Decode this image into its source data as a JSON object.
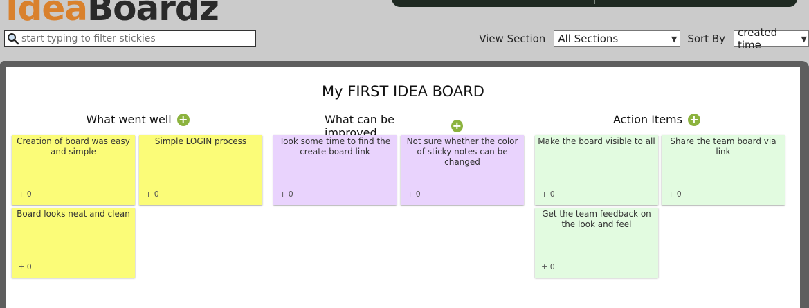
{
  "header": {
    "logo_part1": "Idea",
    "logo_part2": "Boardz",
    "search_placeholder": "start typing to filter stickies",
    "view_section_label": "View Section",
    "view_section_value": "All Sections",
    "sort_by_label": "Sort By",
    "sort_by_value": "created time"
  },
  "board": {
    "title": "My FIRST IDEA BOARD",
    "columns": [
      {
        "title": "What went well",
        "stickies": [
          {
            "text": "Creation of board was easy and simple",
            "votes": "+ 0"
          },
          {
            "text": "Simple LOGIN process",
            "votes": "+ 0"
          },
          {
            "text": "Board looks neat and clean",
            "votes": "+ 0"
          }
        ]
      },
      {
        "title": "What can be improved",
        "stickies": [
          {
            "text": "Took some time to find the create board link",
            "votes": "+ 0"
          },
          {
            "text": "Not sure whether the color of sticky notes can be changed",
            "votes": "+ 0"
          }
        ]
      },
      {
        "title": "Action Items",
        "stickies": [
          {
            "text": "Make the board visible to all",
            "votes": "+ 0"
          },
          {
            "text": "Share the team board via link",
            "votes": "+ 0"
          },
          {
            "text": "Get the team feedback on the look and feel",
            "votes": "+ 0"
          }
        ]
      }
    ]
  },
  "colors": {
    "sticky_yellow": "#fbfc78",
    "sticky_purple": "#e9d3fd",
    "sticky_green": "#e2fbe0",
    "add_button": "#8cb33e",
    "logo_orange": "#d9812d"
  },
  "icons": {
    "search": "search-icon",
    "add": "plus-circle-icon",
    "dropdown": "chevron-down-icon"
  }
}
